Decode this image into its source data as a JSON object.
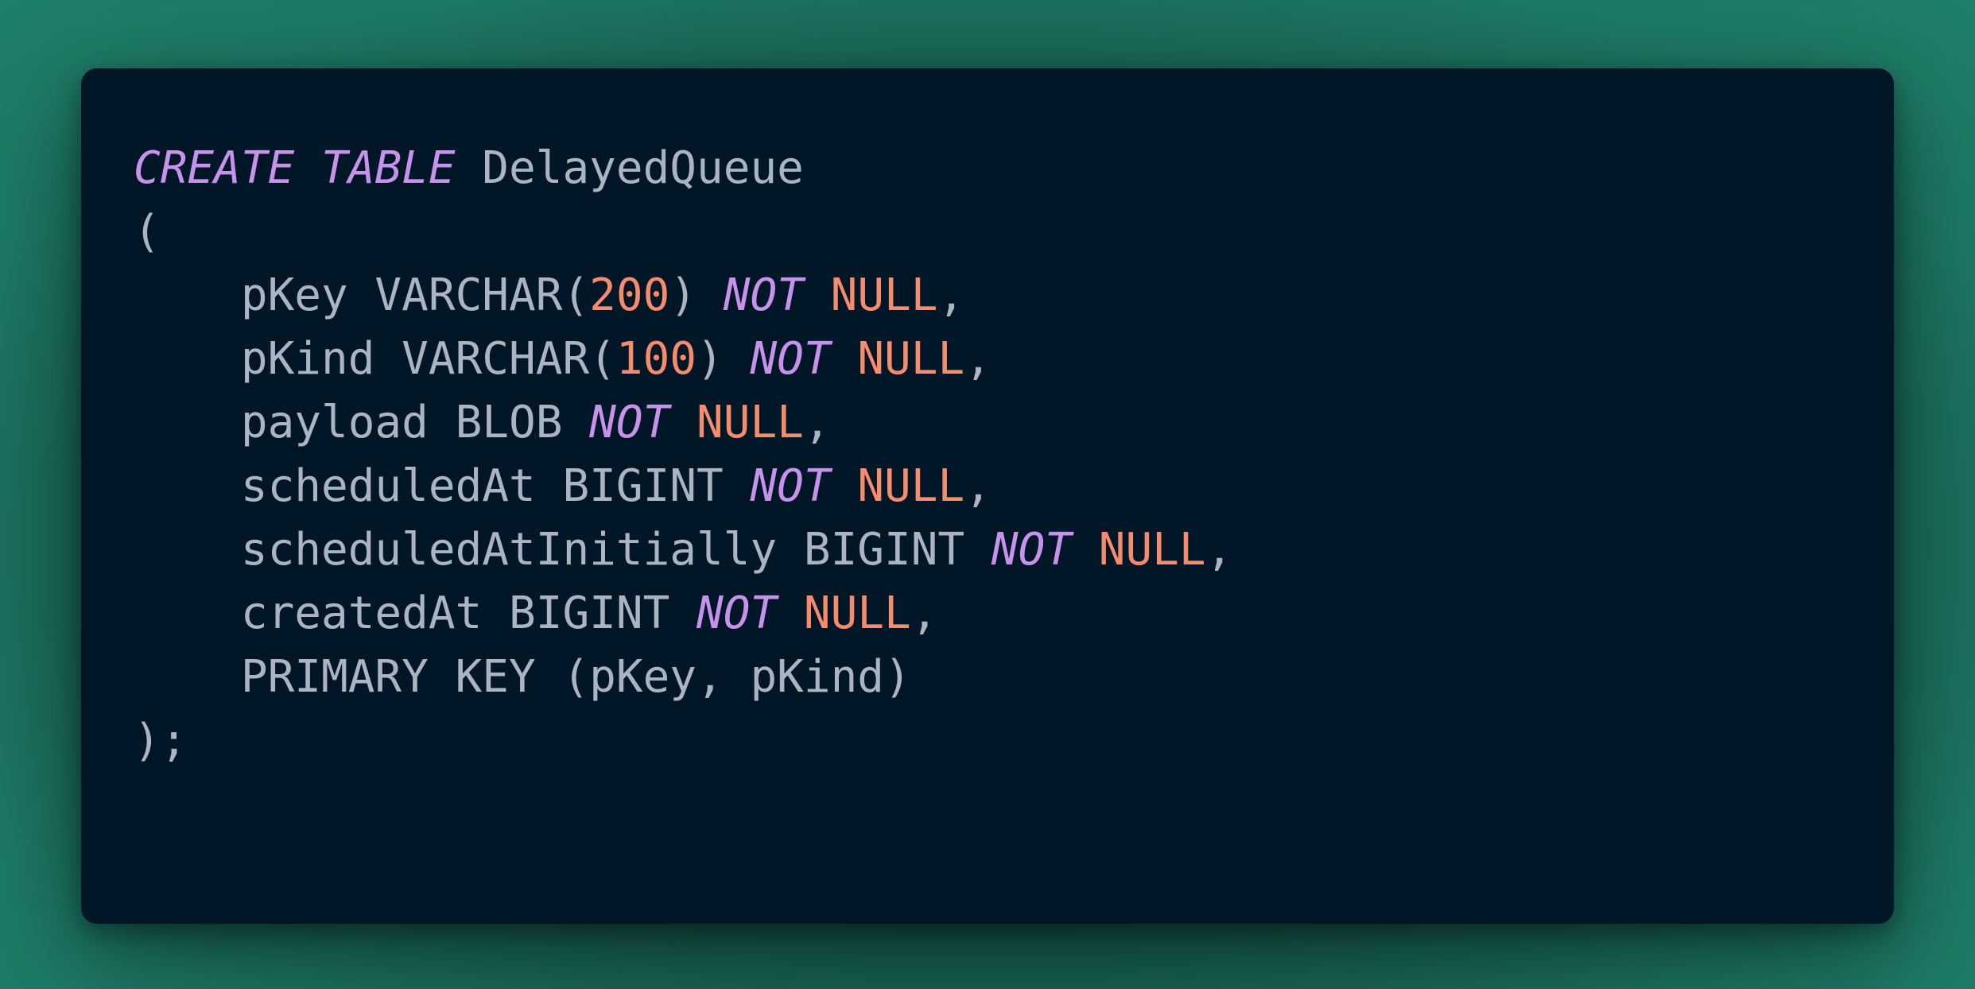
{
  "editor": {
    "background": "#011627",
    "outer_background": "#1e7a66",
    "colors": {
      "text": "#aab4c3",
      "keyword": "#c792ea",
      "number": "#f78c6c"
    },
    "lines": [
      {
        "tokens": [
          {
            "t": "kw",
            "v": "CREATE TABLE"
          },
          {
            "t": "plain",
            "v": " DelayedQueue"
          }
        ]
      },
      {
        "tokens": [
          {
            "t": "plain",
            "v": "("
          }
        ]
      },
      {
        "tokens": [
          {
            "t": "plain",
            "v": "    pKey VARCHAR("
          },
          {
            "t": "num",
            "v": "200"
          },
          {
            "t": "plain",
            "v": ") "
          },
          {
            "t": "kw",
            "v": "NOT"
          },
          {
            "t": "plain",
            "v": " "
          },
          {
            "t": "nul",
            "v": "NULL"
          },
          {
            "t": "plain",
            "v": ","
          }
        ]
      },
      {
        "tokens": [
          {
            "t": "plain",
            "v": "    pKind VARCHAR("
          },
          {
            "t": "num",
            "v": "100"
          },
          {
            "t": "plain",
            "v": ") "
          },
          {
            "t": "kw",
            "v": "NOT"
          },
          {
            "t": "plain",
            "v": " "
          },
          {
            "t": "nul",
            "v": "NULL"
          },
          {
            "t": "plain",
            "v": ","
          }
        ]
      },
      {
        "tokens": [
          {
            "t": "plain",
            "v": "    payload BLOB "
          },
          {
            "t": "kw",
            "v": "NOT"
          },
          {
            "t": "plain",
            "v": " "
          },
          {
            "t": "nul",
            "v": "NULL"
          },
          {
            "t": "plain",
            "v": ","
          }
        ]
      },
      {
        "tokens": [
          {
            "t": "plain",
            "v": "    scheduledAt BIGINT "
          },
          {
            "t": "kw",
            "v": "NOT"
          },
          {
            "t": "plain",
            "v": " "
          },
          {
            "t": "nul",
            "v": "NULL"
          },
          {
            "t": "plain",
            "v": ","
          }
        ]
      },
      {
        "tokens": [
          {
            "t": "plain",
            "v": "    scheduledAtInitially BIGINT "
          },
          {
            "t": "kw",
            "v": "NOT"
          },
          {
            "t": "plain",
            "v": " "
          },
          {
            "t": "nul",
            "v": "NULL"
          },
          {
            "t": "plain",
            "v": ","
          }
        ]
      },
      {
        "tokens": [
          {
            "t": "plain",
            "v": "    createdAt BIGINT "
          },
          {
            "t": "kw",
            "v": "NOT"
          },
          {
            "t": "plain",
            "v": " "
          },
          {
            "t": "nul",
            "v": "NULL"
          },
          {
            "t": "plain",
            "v": ","
          }
        ]
      },
      {
        "tokens": [
          {
            "t": "plain",
            "v": "    PRIMARY KEY (pKey, pKind)"
          }
        ]
      },
      {
        "tokens": [
          {
            "t": "plain",
            "v": ");"
          }
        ]
      }
    ]
  }
}
